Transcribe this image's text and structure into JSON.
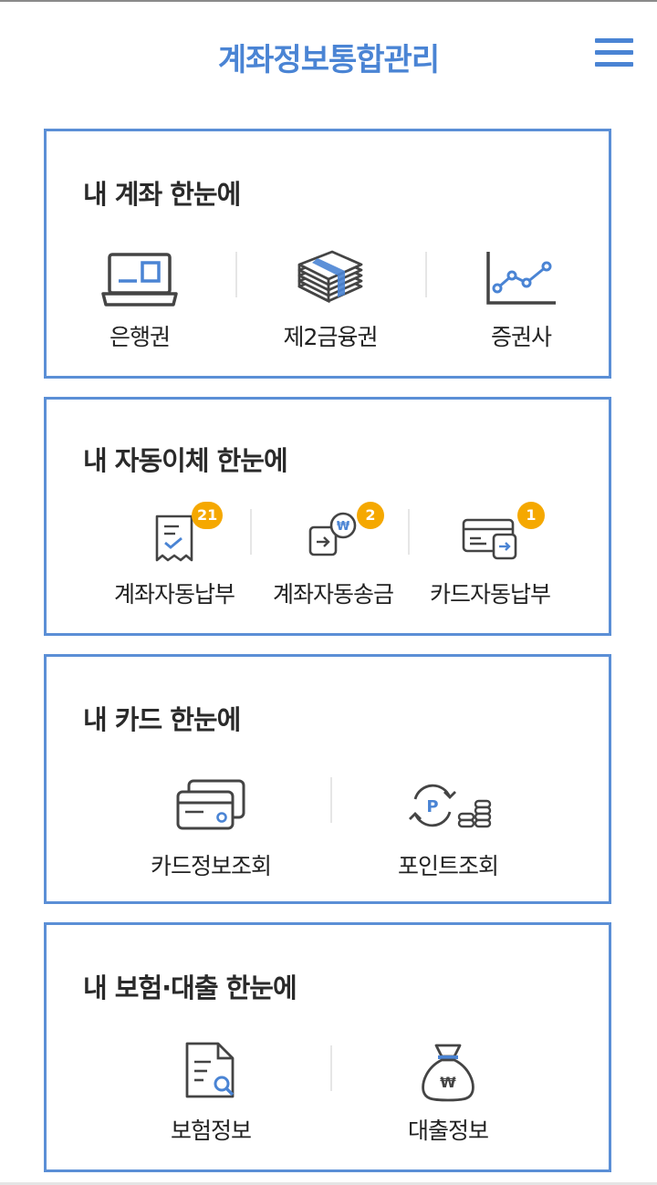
{
  "header": {
    "title": "계좌정보통합관리"
  },
  "accounts": {
    "title": "내 계좌 한눈에",
    "items": [
      {
        "label": "은행권",
        "icon": "laptop-icon"
      },
      {
        "label": "제2금융권",
        "icon": "money-stack-icon"
      },
      {
        "label": "증권사",
        "icon": "line-chart-icon"
      }
    ]
  },
  "autotransfer": {
    "title": "내 자동이체 한눈에",
    "items": [
      {
        "label": "계좌자동납부",
        "badge": "21",
        "icon": "receipt-icon"
      },
      {
        "label": "계좌자동송금",
        "badge": "2",
        "icon": "won-transfer-icon"
      },
      {
        "label": "카드자동납부",
        "badge": "1",
        "icon": "card-transfer-icon"
      }
    ]
  },
  "cards": {
    "title": "내 카드 한눈에",
    "items": [
      {
        "label": "카드정보조회",
        "icon": "credit-cards-icon"
      },
      {
        "label": "포인트조회",
        "icon": "points-icon"
      }
    ]
  },
  "insurance": {
    "title": "내 보험·대출 한눈에",
    "items": [
      {
        "label": "보험정보",
        "icon": "document-search-icon"
      },
      {
        "label": "대출정보",
        "icon": "money-bag-icon"
      }
    ]
  },
  "colors": {
    "accent": "#4a84d4",
    "border": "#5b8fd6",
    "badge": "#f5a800",
    "icon": "#444444"
  }
}
